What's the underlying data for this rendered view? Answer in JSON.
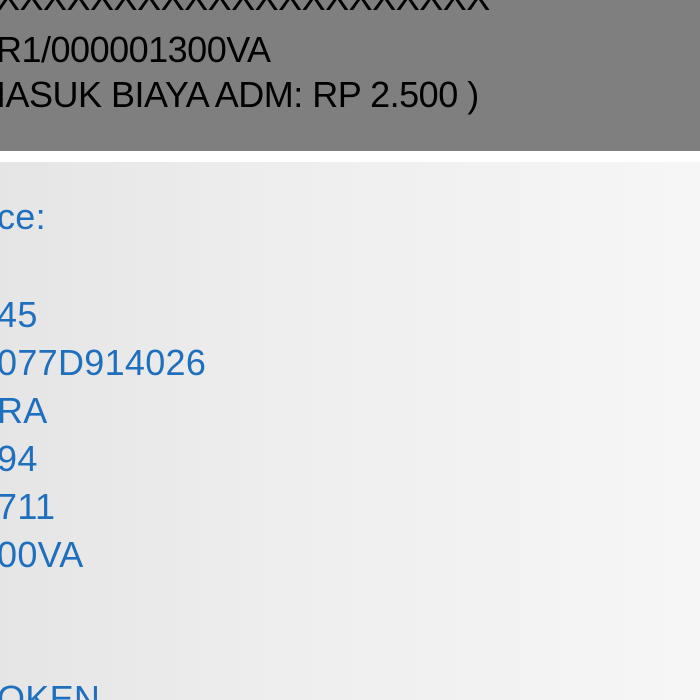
{
  "banner": {
    "line1": "XXXXXXXXXXXXXXXXXXXXX",
    "line2": "R1/000001300VA",
    "line3": "IASUK BIAYA ADM: RP 2.500 )"
  },
  "detail": {
    "heading": "ce:",
    "rows": [
      "45",
      "077D914026",
      "RA",
      "94",
      "711",
      "00VA"
    ],
    "footer": "OKEN"
  },
  "colors": {
    "banner_bg": "#7f7f7f",
    "text_blue": "#1f6fbf"
  }
}
